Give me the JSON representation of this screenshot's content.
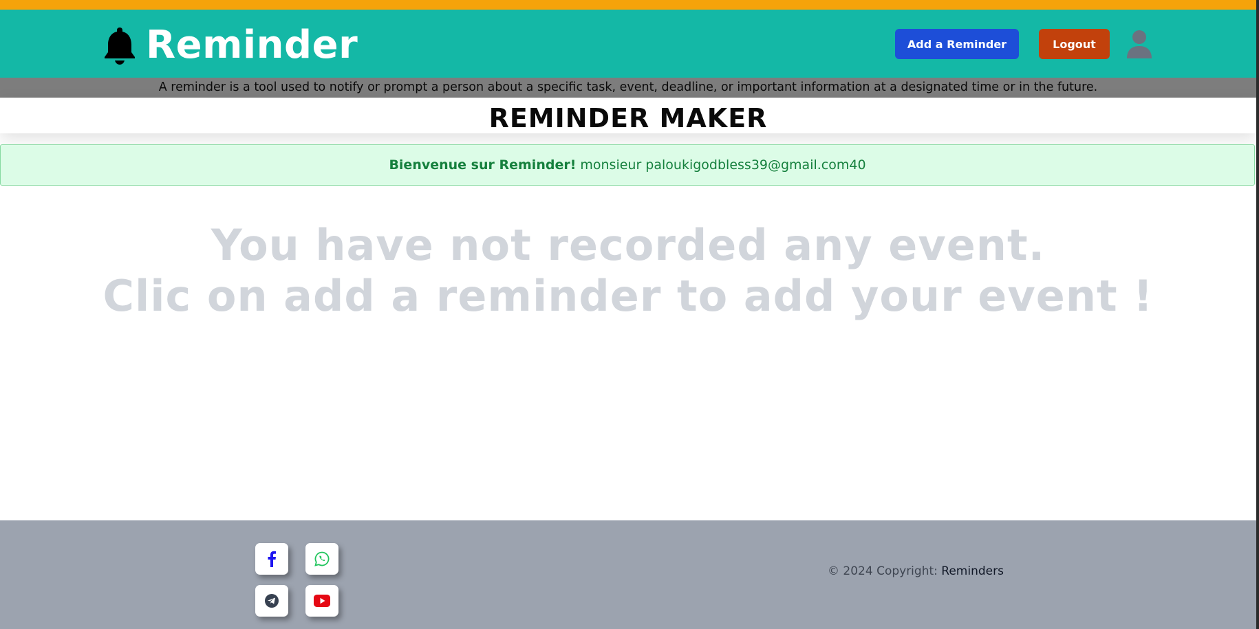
{
  "header": {
    "brand": "Reminder",
    "add_button": "Add a Reminder",
    "logout_button": "Logout"
  },
  "tagline": "A reminder is a tool used to notify or prompt a person about a specific task, event, deadline, or important information at a designated time or in the future.",
  "main": {
    "title": "REMINDER MAKER",
    "alert_strong": "Bienvenue sur Reminder!",
    "alert_text": "monsieur paloukigodbless39@gmail.com40",
    "empty_line1": "You have not recorded any event.",
    "empty_line2": "Clic on add a reminder to add your event !"
  },
  "footer": {
    "copyright_prefix": "© 2024 Copyright:",
    "copyright_link": "Reminders",
    "social_icons": [
      "facebook-icon",
      "whatsapp-icon",
      "telegram-icon",
      "youtube-icon"
    ]
  },
  "colors": {
    "top_stripe": "#f5a30a",
    "navbar": "#14b8a6",
    "add_button": "#1d4ed8",
    "logout_button": "#c2410c",
    "alert_bg": "#dcfce7",
    "alert_text": "#15803d",
    "footer": "#9ca3af"
  }
}
